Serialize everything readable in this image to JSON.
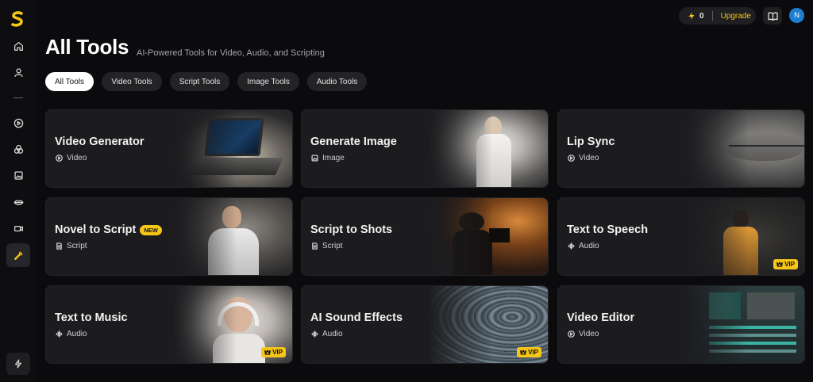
{
  "sidebar": {
    "logo": "S",
    "items": [
      {
        "name": "home",
        "icon": "home-icon"
      },
      {
        "name": "profile",
        "icon": "user-icon"
      },
      {
        "name": "video",
        "icon": "play-circle-icon"
      },
      {
        "name": "effects",
        "icon": "circles-icon"
      },
      {
        "name": "images",
        "icon": "image-icon"
      },
      {
        "name": "lip-sync",
        "icon": "lips-icon"
      },
      {
        "name": "camera",
        "icon": "camera-icon"
      },
      {
        "name": "tools",
        "icon": "wrench-icon",
        "active": true
      }
    ],
    "bottom_icon": "bolt-icon"
  },
  "header": {
    "credits": "0",
    "upgrade_label": "Upgrade",
    "avatar_initial": "N",
    "accent_color": "#f5c518",
    "avatar_color": "#1e7fd1"
  },
  "page": {
    "title": "All Tools",
    "subtitle": "AI-Powered Tools for Video, Audio, and Scripting"
  },
  "tabs": [
    {
      "label": "All Tools",
      "active": true
    },
    {
      "label": "Video Tools"
    },
    {
      "label": "Script Tools"
    },
    {
      "label": "Image Tools"
    },
    {
      "label": "Audio Tools"
    }
  ],
  "cards": [
    {
      "title": "Video Generator",
      "category": "Video",
      "category_icon": "play-circle-icon"
    },
    {
      "title": "Generate Image",
      "category": "Image",
      "category_icon": "image-icon"
    },
    {
      "title": "Lip Sync",
      "category": "Video",
      "category_icon": "play-circle-icon"
    },
    {
      "title": "Novel to Script",
      "category": "Script",
      "category_icon": "document-icon",
      "badge": "NEW"
    },
    {
      "title": "Script to Shots",
      "category": "Script",
      "category_icon": "document-icon"
    },
    {
      "title": "Text to Speech",
      "category": "Audio",
      "category_icon": "audio-wave-icon",
      "vip": "VIP"
    },
    {
      "title": "Text to Music",
      "category": "Audio",
      "category_icon": "audio-wave-icon",
      "vip": "VIP"
    },
    {
      "title": "AI Sound Effects",
      "category": "Audio",
      "category_icon": "audio-wave-icon",
      "vip": "VIP"
    },
    {
      "title": "Video Editor",
      "category": "Video",
      "category_icon": "play-circle-icon"
    }
  ]
}
